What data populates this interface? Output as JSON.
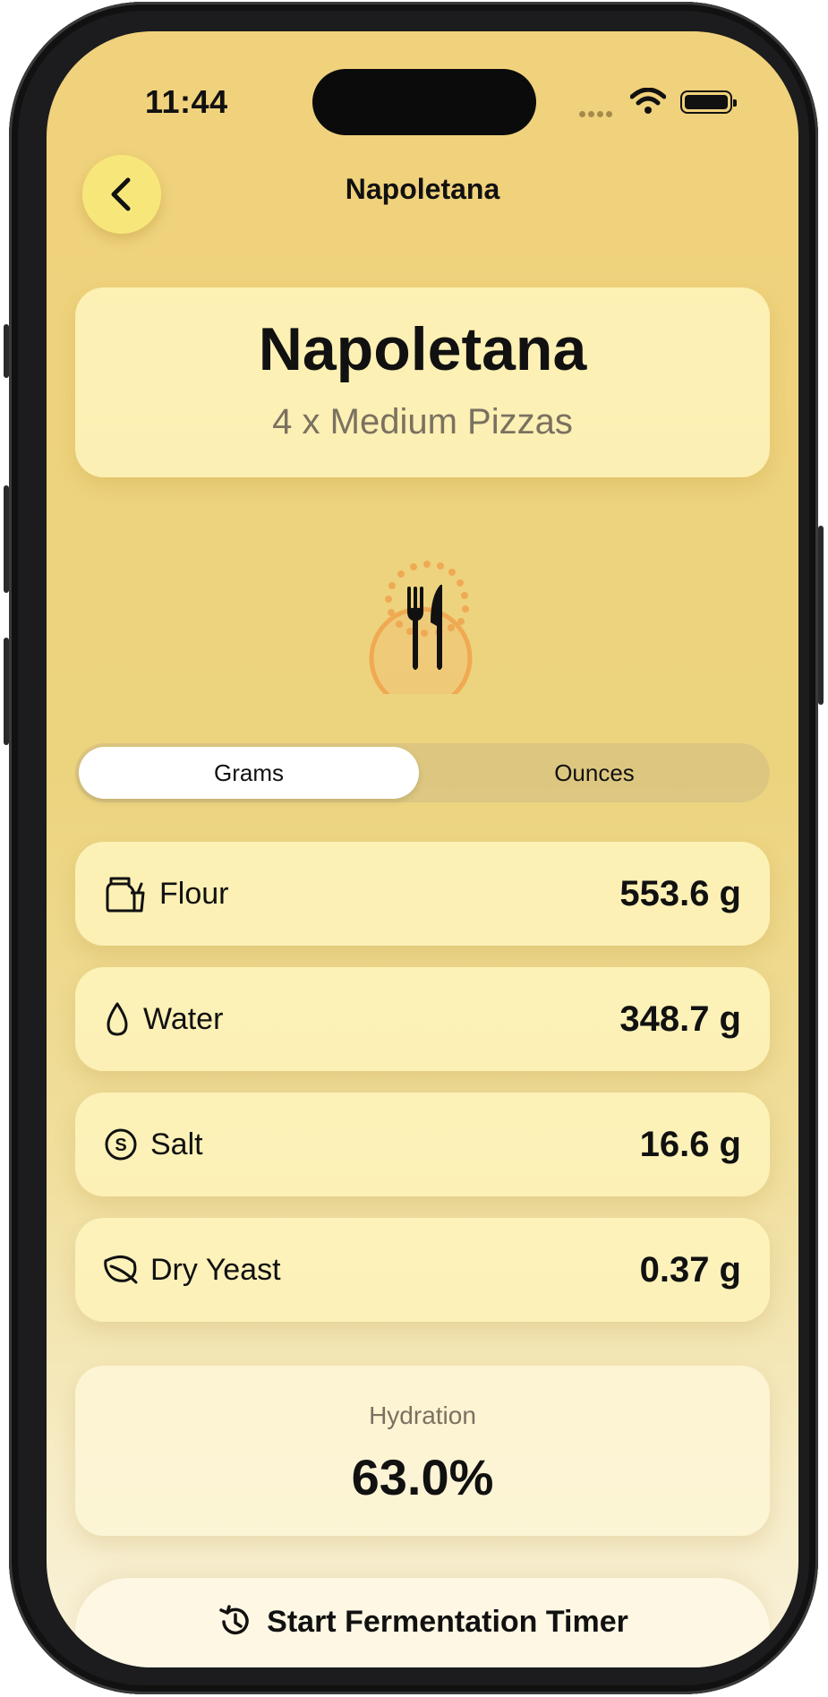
{
  "status_bar": {
    "time": "11:44"
  },
  "nav": {
    "title": "Napoletana",
    "back_icon": "chevron-left-icon"
  },
  "recipe": {
    "title": "Napoletana",
    "subtitle": "4 x Medium Pizzas"
  },
  "center_icon": "fork-knife-icon",
  "units": {
    "options": [
      "Grams",
      "Ounces"
    ],
    "selected": "Grams"
  },
  "ingredients": [
    {
      "name": "Flour",
      "value": "553.6 g",
      "icon": "flour-bag-icon"
    },
    {
      "name": "Water",
      "value": "348.7 g",
      "icon": "water-drop-icon"
    },
    {
      "name": "Salt",
      "value": "16.6 g",
      "icon": "salt-coin-icon"
    },
    {
      "name": "Dry Yeast",
      "value": "0.37 g",
      "icon": "leaf-icon"
    }
  ],
  "hydration": {
    "label": "Hydration",
    "value": "63.0%"
  },
  "timer_button": {
    "label": "Start Fermentation Timer",
    "icon": "timer-icon"
  },
  "colors": {
    "accent_orange": "#f0a24a",
    "card_yellow": "#fdf2b9",
    "back_button": "#f7e77a"
  }
}
